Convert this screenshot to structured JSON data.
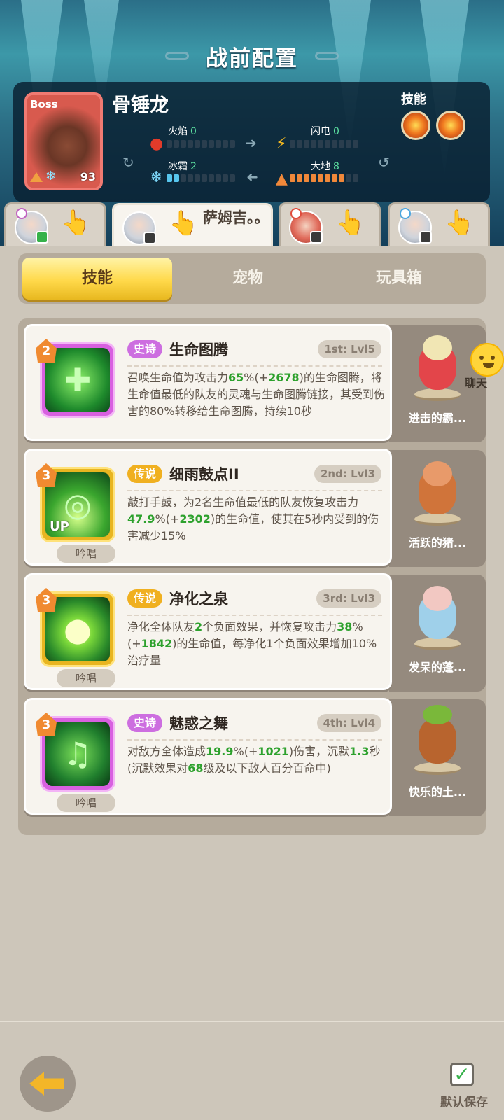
{
  "header": {
    "title": "战前配置"
  },
  "boss": {
    "tag": "Boss",
    "name": "骨锤龙",
    "level": "93",
    "skills_label": "技能",
    "elements": [
      {
        "name": "火焰",
        "value": "0",
        "filled": 0
      },
      {
        "name": "闪电",
        "value": "0",
        "filled": 0
      },
      {
        "name": "冰霜",
        "value": "2",
        "filled": 2
      },
      {
        "name": "大地",
        "value": "8",
        "filled": 8
      }
    ]
  },
  "heroes": [
    {
      "name": ""
    },
    {
      "name": "萨姆吉。。",
      "active": true
    },
    {
      "name": ""
    },
    {
      "name": ""
    }
  ],
  "tabs": [
    {
      "label": "技能",
      "active": true
    },
    {
      "label": "宠物"
    },
    {
      "label": "玩具箱"
    }
  ],
  "skills": [
    {
      "num": "2",
      "rarity": "史诗",
      "name": "生命图腾",
      "slot": "1st: Lvl5",
      "chant": "",
      "desc_html": "召唤生命值为攻击力<b>65</b>%(+<b>2678</b>)的生命图腾，将生命值最低的队友的灵魂与生命图腾链接，其受到伤害的80%转移给生命图腾，持续10秒",
      "pet": "进击的霸..."
    },
    {
      "num": "3",
      "rarity": "传说",
      "name": "细雨鼓点II",
      "slot": "2nd: Lvl3",
      "chant": "吟唱",
      "up": "UP",
      "desc_html": "敲打手鼓，为2名生命值最低的队友恢复攻击力<b>47.9</b>%(+<b>2302</b>)的生命值，使其在5秒内受到的伤害减少15%",
      "pet": "活跃的猪..."
    },
    {
      "num": "3",
      "rarity": "传说",
      "name": "净化之泉",
      "slot": "3rd: Lvl3",
      "chant": "吟唱",
      "desc_html": "净化全体队友<b>2</b>个负面效果，并恢复攻击力<b>38</b>%(+<b>1842</b>)的生命值，每净化1个负面效果增加10%治疗量",
      "pet": "发呆的蓬..."
    },
    {
      "num": "3",
      "rarity": "史诗",
      "name": "魅惑之舞",
      "slot": "4th: Lvl4",
      "chant": "吟唱",
      "desc_html": "对敌方全体造成<b>19.9</b>%(+<b>1021</b>)伤害，沉默<b>1.3</b>秒(沉默效果对<b>68</b>级及以下敌人百分百命中)",
      "pet": "快乐的土..."
    }
  ],
  "chat": {
    "label": "聊天"
  },
  "footer": {
    "save_label": "默认保存"
  },
  "colors": {
    "accent": "#ffd94a",
    "epic": "#cd6ee0",
    "legend": "#f0b020",
    "highlight": "#2da12d"
  }
}
